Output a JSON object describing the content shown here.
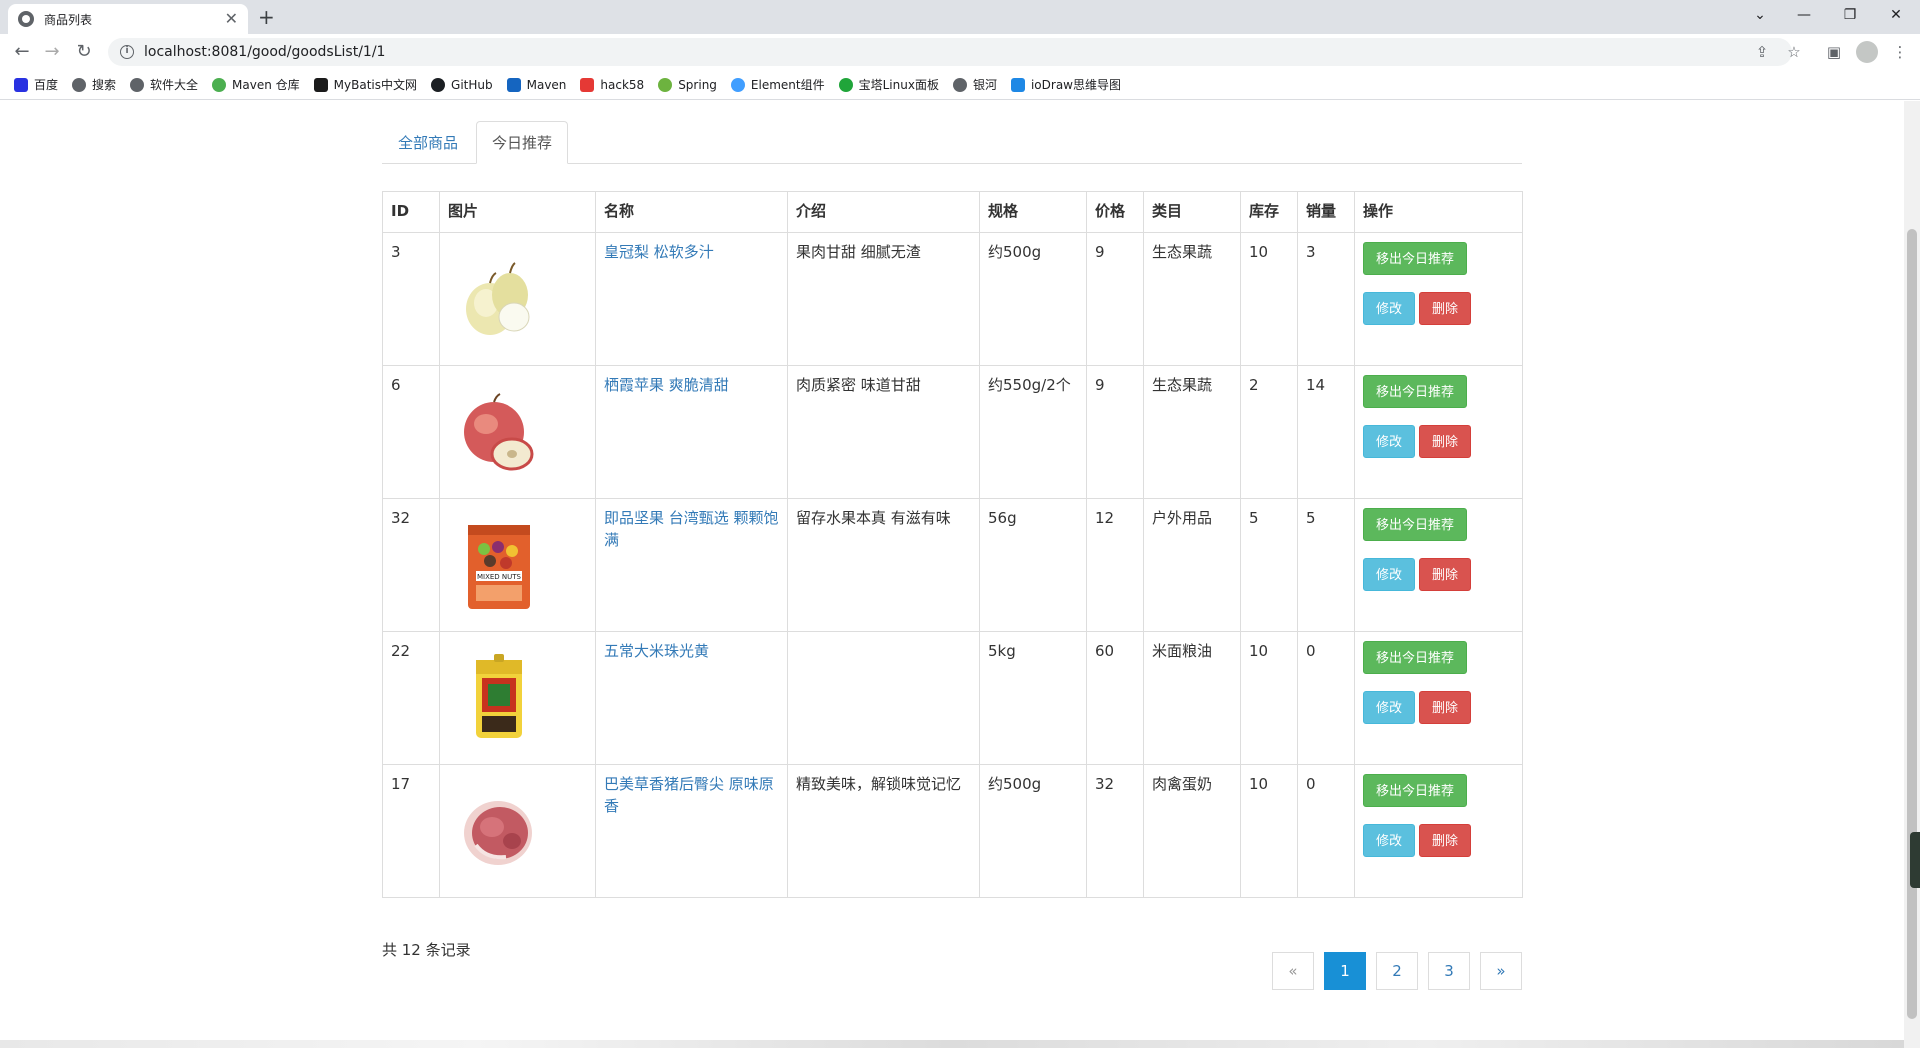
{
  "browser": {
    "tab_title": "商品列表",
    "url": "localhost:8081/good/goodsList/1/1",
    "bookmarks": [
      {
        "label": "百度",
        "icon": "baidu-icon",
        "color": "#2932e1"
      },
      {
        "label": "搜索",
        "icon": "globe-icon",
        "color": "#5f6368"
      },
      {
        "label": "软件大全",
        "icon": "globe-icon",
        "color": "#5f6368"
      },
      {
        "label": "Maven 仓库",
        "icon": "maven-repo-icon",
        "color": "#4caf50"
      },
      {
        "label": "MyBatis中文网",
        "icon": "mybatis-icon",
        "color": "#1b1b1b"
      },
      {
        "label": "GitHub",
        "icon": "github-icon",
        "color": "#1b1f23"
      },
      {
        "label": "Maven",
        "icon": "maven-icon",
        "color": "#1565c0"
      },
      {
        "label": "hack58",
        "icon": "hack58-icon",
        "color": "#e53935"
      },
      {
        "label": "Spring",
        "icon": "spring-icon",
        "color": "#6db33f"
      },
      {
        "label": "Element组件",
        "icon": "element-icon",
        "color": "#409eff"
      },
      {
        "label": "宝塔Linux面板",
        "icon": "baota-icon",
        "color": "#20a53a"
      },
      {
        "label": "银河",
        "icon": "globe-icon",
        "color": "#5f6368"
      },
      {
        "label": "ioDraw思维导图",
        "icon": "iodraw-icon",
        "color": "#1e88e5"
      }
    ]
  },
  "tabs": [
    {
      "label": "全部商品",
      "active": false
    },
    {
      "label": "今日推荐",
      "active": true
    }
  ],
  "table": {
    "headers": [
      "ID",
      "图片",
      "名称",
      "介绍",
      "规格",
      "价格",
      "类目",
      "库存",
      "销量",
      "操作"
    ],
    "rows": [
      {
        "id": "3",
        "image": "pear-image",
        "name": "皇冠梨 松软多汁",
        "intro": "果肉甘甜 细腻无渣",
        "spec": "约500g",
        "price": "9",
        "category": "生态果蔬",
        "stock": "10",
        "sales": "3"
      },
      {
        "id": "6",
        "image": "apple-image",
        "name": "栖霞苹果 爽脆清甜",
        "intro": "肉质紧密 味道甘甜",
        "spec": "约550g/2个",
        "price": "9",
        "category": "生态果蔬",
        "stock": "2",
        "sales": "14"
      },
      {
        "id": "32",
        "image": "nuts-bag-image",
        "name": "即品坚果 台湾甄选 颗颗饱满",
        "intro": "留存水果本真 有滋有味",
        "spec": "56g",
        "price": "12",
        "category": "户外用品",
        "stock": "5",
        "sales": "5"
      },
      {
        "id": "22",
        "image": "rice-bag-image",
        "name": "五常大米珠光黄",
        "intro": "",
        "spec": "5kg",
        "price": "60",
        "category": "米面粮油",
        "stock": "10",
        "sales": "0"
      },
      {
        "id": "17",
        "image": "pork-image",
        "name": "巴美草香猪后臀尖 原味原香",
        "intro": "精致美味，解锁味觉记忆",
        "spec": "约500g",
        "price": "32",
        "category": "肉禽蛋奶",
        "stock": "10",
        "sales": "0"
      }
    ],
    "actions": {
      "remove_recommend": "移出今日推荐",
      "edit": "修改",
      "delete": "删除"
    }
  },
  "footer": {
    "total_text": "共 12 条记录",
    "pagination": {
      "prev": "«",
      "pages": [
        "1",
        "2",
        "3"
      ],
      "current": "1",
      "next": "»"
    }
  },
  "colors": {
    "link": "#337ab7",
    "success": "#5cb85c",
    "info": "#5bc0de",
    "danger": "#d9534f",
    "active_page": "#1890d6"
  }
}
